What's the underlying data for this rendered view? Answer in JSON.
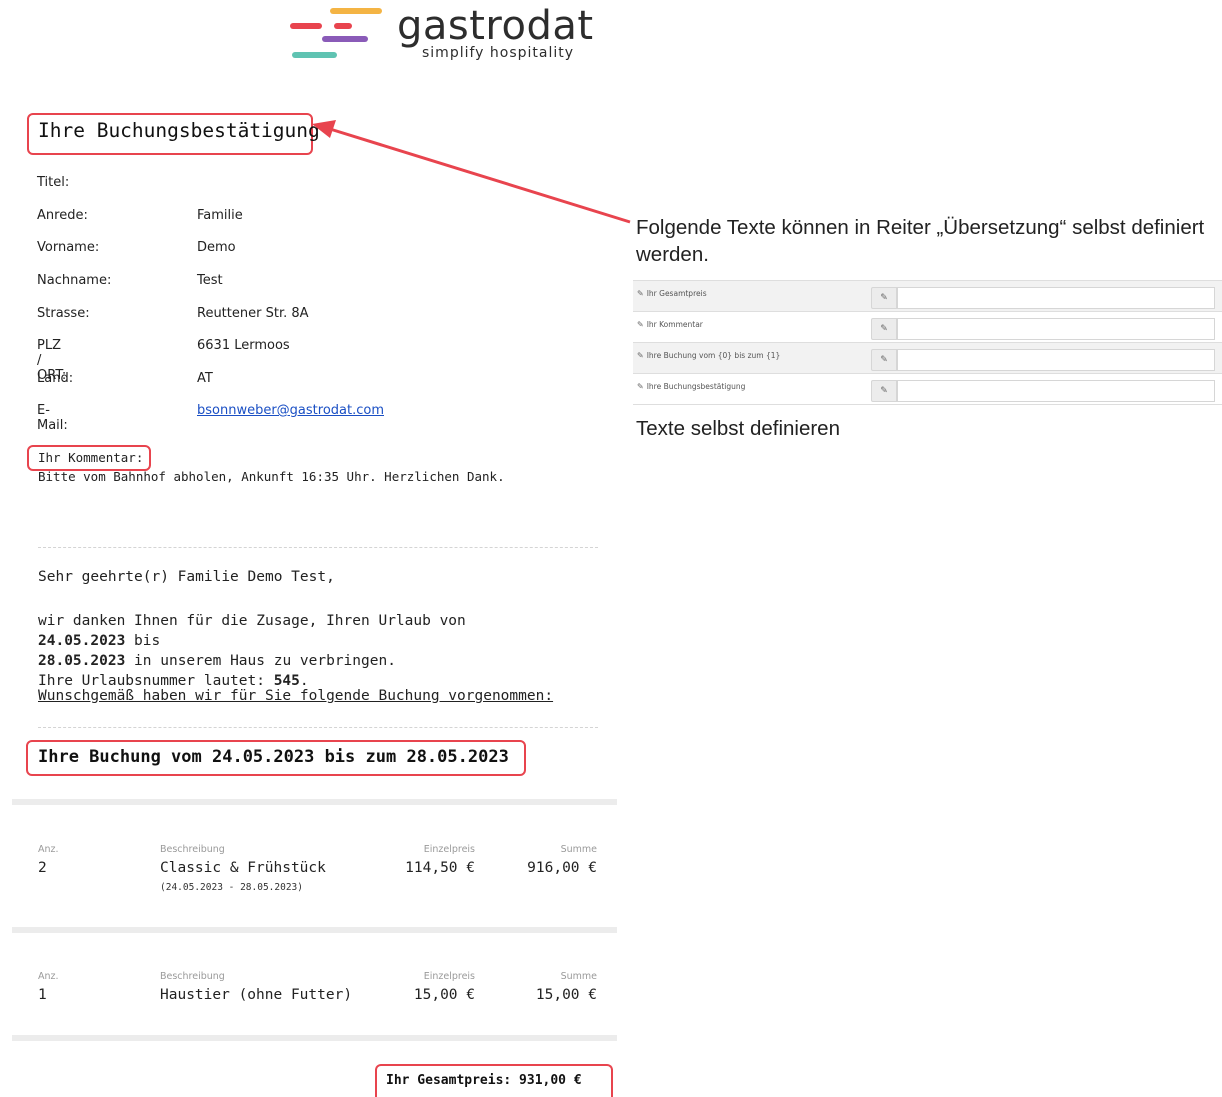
{
  "logo": {
    "word": "gastrodat",
    "tagline": "simplify hospitality",
    "colors": {
      "orange": "#f4b444",
      "red": "#e8444e",
      "blue": "#5b6fd6",
      "purple": "#8a5bb8",
      "teal": "#5fc3b2"
    }
  },
  "confirmation": {
    "title": "Ihre Buchungsbestätigung"
  },
  "fields": [
    {
      "label": "Titel:",
      "value": ""
    },
    {
      "label": "Anrede:",
      "value": "Familie"
    },
    {
      "label": "Vorname:",
      "value": "Demo"
    },
    {
      "label": "Nachname:",
      "value": "Test"
    },
    {
      "label": "Strasse:",
      "value": "Reuttener Str. 8A"
    },
    {
      "label": "PLZ / ORT:",
      "value": "6631 Lermoos"
    },
    {
      "label": "Land:",
      "value": "AT"
    },
    {
      "label": "E-Mail:",
      "value": "bsonnweber@gastrodat.com"
    }
  ],
  "comment": {
    "label": "Ihr Kommentar:",
    "text": "Bitte vom Bahnhof abholen, Ankunft 16:35 Uhr. Herzlichen Dank."
  },
  "letter": {
    "greeting": "Sehr geehrte(r) Familie Demo Test,",
    "p1_a": "wir danken Ihnen für die Zusage, Ihren Urlaub von ",
    "date_from": "24.05.2023",
    "p1_b": " bis",
    "date_to": "28.05.2023",
    "p1_c": " in unserem Haus zu verbringen.",
    "p2_a": "Ihre Urlaubsnummer lautet: ",
    "number": "545",
    "p2_b": ".",
    "wunsch": "Wunschgemäß haben wir für Sie folgende Buchung vorgenommen:"
  },
  "booking": {
    "title": "Ihre Buchung vom 24.05.2023 bis zum 28.05.2023"
  },
  "columns": {
    "qty": "Anz.",
    "desc": "Beschreibung",
    "unit": "Einzelpreis",
    "sum": "Summe"
  },
  "items": [
    {
      "qty": "2",
      "desc": "Classic & Frühstück",
      "sub": "(24.05.2023 - 28.05.2023)",
      "unit": "114,50 €",
      "sum": "916,00 €"
    },
    {
      "qty": "1",
      "desc": "Haustier (ohne Futter)",
      "sub": "",
      "unit": "15,00 €",
      "sum": "15,00 €"
    }
  ],
  "total": "Ihr Gesamtpreis: 931,00 €",
  "note": {
    "text": "Folgende Texte können in Reiter „Übersetzung“ selbst definiert werden.",
    "caption": "Texte selbst definieren"
  },
  "translations": [
    {
      "label": "Ihr Gesamtpreis",
      "value": ""
    },
    {
      "label": "Ihr Kommentar",
      "value": ""
    },
    {
      "label": "Ihre Buchung vom {0} bis zum {1}",
      "value": ""
    },
    {
      "label": "Ihre Buchungsbestätigung",
      "value": ""
    }
  ],
  "highlight_color": "#e8444e"
}
